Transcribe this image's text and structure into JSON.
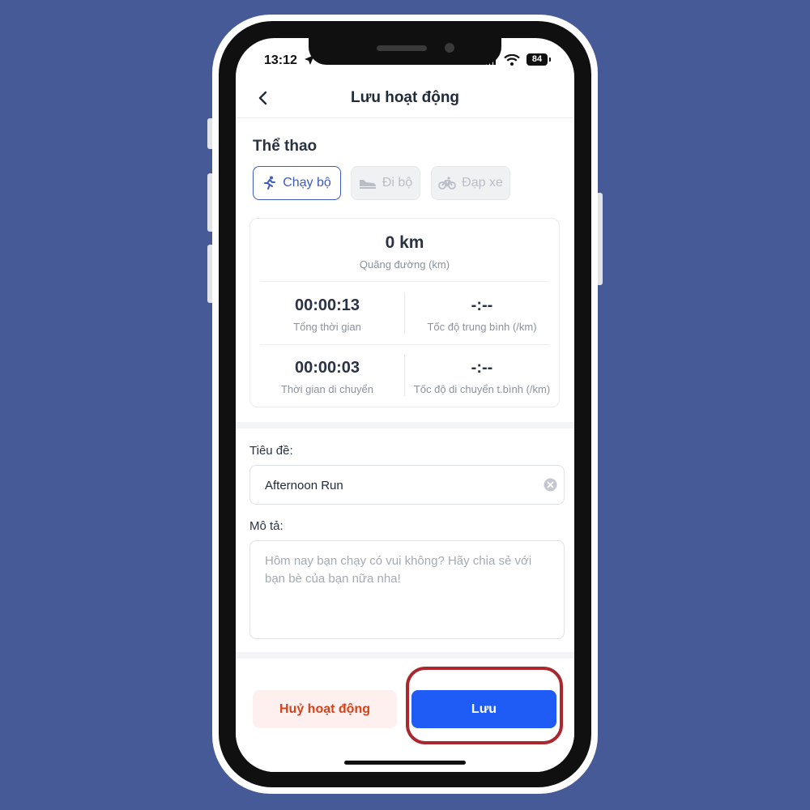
{
  "status_bar": {
    "time": "13:12",
    "battery": "84"
  },
  "header": {
    "title": "Lưu hoạt động"
  },
  "sport": {
    "section_title": "Thể thao",
    "options": [
      {
        "label": "Chạy bộ",
        "icon": "running-icon",
        "selected": true
      },
      {
        "label": "Đi bộ",
        "icon": "shoe-icon",
        "selected": false
      },
      {
        "label": "Đạp xe",
        "icon": "bicycle-icon",
        "selected": false
      }
    ]
  },
  "stats": {
    "distance": {
      "value": "0 km",
      "label": "Quãng đường (km)"
    },
    "total_time": {
      "value": "00:00:13",
      "label": "Tổng thời gian"
    },
    "avg_pace": {
      "value": "-:--",
      "label": "Tốc độ trung bình (/km)"
    },
    "moving_time": {
      "value": "00:00:03",
      "label": "Thời gian di chuyển"
    },
    "moving_pace": {
      "value": "-:--",
      "label": "Tốc độ di chuyển t.bình (/km)"
    }
  },
  "form": {
    "title_label": "Tiêu đề:",
    "title_value": "Afternoon Run",
    "description_label": "Mô tả:",
    "description_placeholder": "Hôm nay bạn chạy có vui không? Hãy chia sẻ với bạn bè của bạn nữa nha!"
  },
  "actions": {
    "cancel_label": "Huỷ hoạt động",
    "save_label": "Lưu"
  },
  "colors": {
    "background": "#455a96",
    "accent": "#1f5cf5",
    "danger": "#d0451e",
    "highlight": "#a8282e"
  }
}
